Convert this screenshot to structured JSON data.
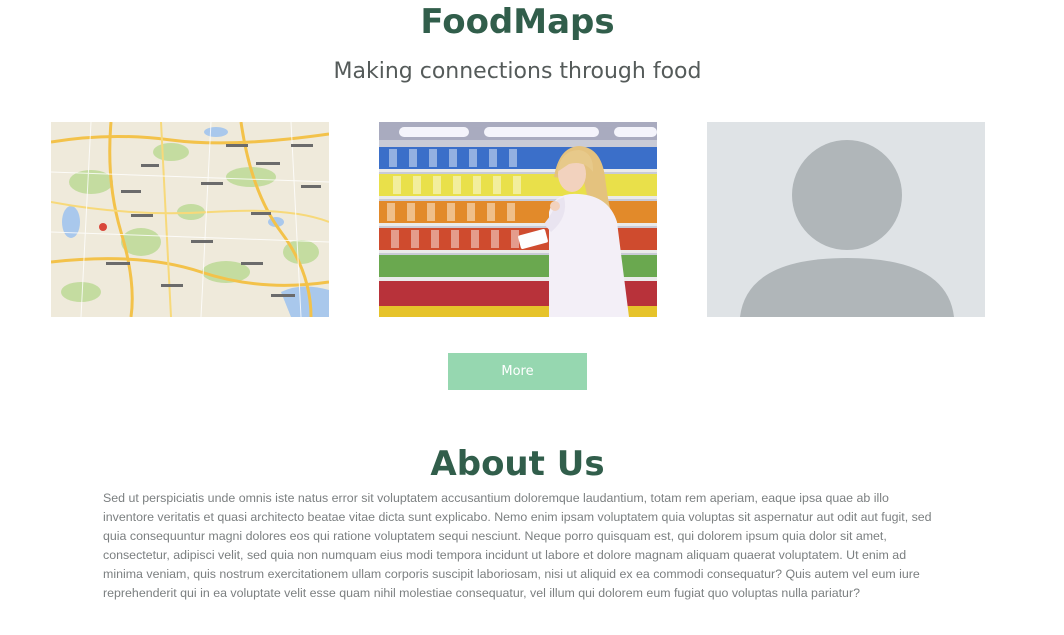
{
  "header": {
    "title": "FoodMaps",
    "tagline": "Making connections through food"
  },
  "cards": [
    {
      "image": "map-image"
    },
    {
      "image": "grocery-shopper-image"
    },
    {
      "image": "profile-placeholder-image"
    }
  ],
  "actions": {
    "more_label": "More"
  },
  "about": {
    "heading": "About Us",
    "body": "Sed ut perspiciatis unde omnis iste natus error sit voluptatem accusantium doloremque laudantium, totam rem aperiam, eaque ipsa quae ab illo inventore veritatis et quasi architecto beatae vitae dicta sunt explicabo. Nemo enim ipsam voluptatem quia voluptas sit aspernatur aut odit aut fugit, sed quia consequuntur magni dolores eos qui ratione voluptatem sequi nesciunt. Neque porro quisquam est, qui dolorem ipsum quia dolor sit amet, consectetur, adipisci velit, sed quia non numquam eius modi tempora incidunt ut labore et dolore magnam aliquam quaerat voluptatem. Ut enim ad minima veniam, quis nostrum exercitationem ullam corporis suscipit laboriosam, nisi ut aliquid ex ea commodi consequatur? Quis autem vel eum iure reprehenderit qui in ea voluptate velit esse quam nihil molestiae consequatur, vel illum qui dolorem eum fugiat quo voluptas nulla pariatur?"
  },
  "colors": {
    "brand": "#315e4b",
    "button": "#96d7b0"
  }
}
